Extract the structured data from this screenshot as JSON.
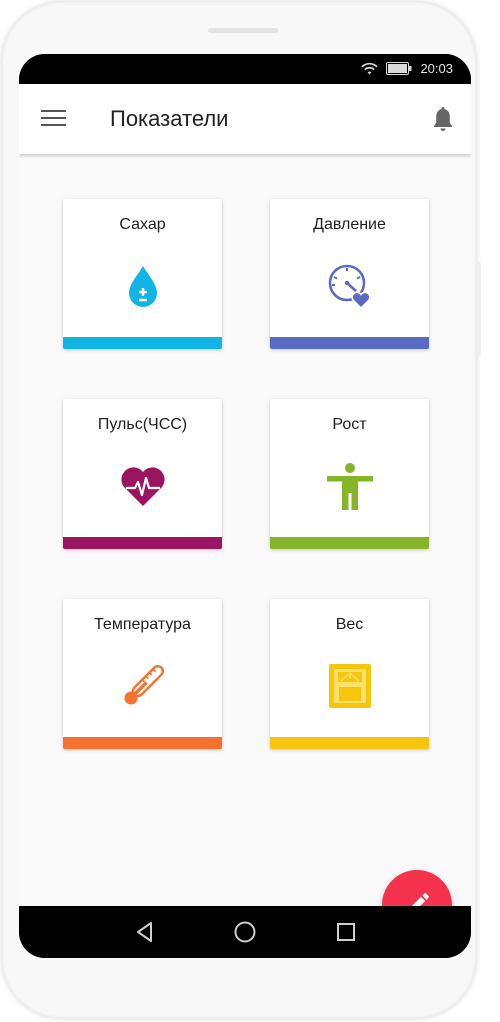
{
  "status_bar": {
    "time": "20:03",
    "wifi_icon": "wifi-icon",
    "battery_icon": "battery-icon"
  },
  "app_bar": {
    "title": "Показатели",
    "menu_icon": "hamburger-menu-icon",
    "notification_icon": "bell-icon"
  },
  "cards": [
    {
      "label": "Сахар",
      "icon": "blood-drop-icon",
      "color": "#10b5e6"
    },
    {
      "label": "Давление",
      "icon": "blood-pressure-gauge-icon",
      "color": "#5a6bc5"
    },
    {
      "label": "Пульс(ЧСС)",
      "icon": "heart-pulse-icon",
      "color": "#9b1460"
    },
    {
      "label": "Рост",
      "icon": "person-figure-icon",
      "color": "#86b52a"
    },
    {
      "label": "Температура",
      "icon": "thermometer-icon",
      "color": "#f5722f"
    },
    {
      "label": "Вес",
      "icon": "weight-scale-icon",
      "color": "#f6c60e"
    }
  ],
  "fab": {
    "icon": "pencil-icon",
    "color": "#f5334d"
  },
  "nav_bar": {
    "back_icon": "back-triangle-icon",
    "home_icon": "home-circle-icon",
    "recents_icon": "recents-square-icon"
  }
}
